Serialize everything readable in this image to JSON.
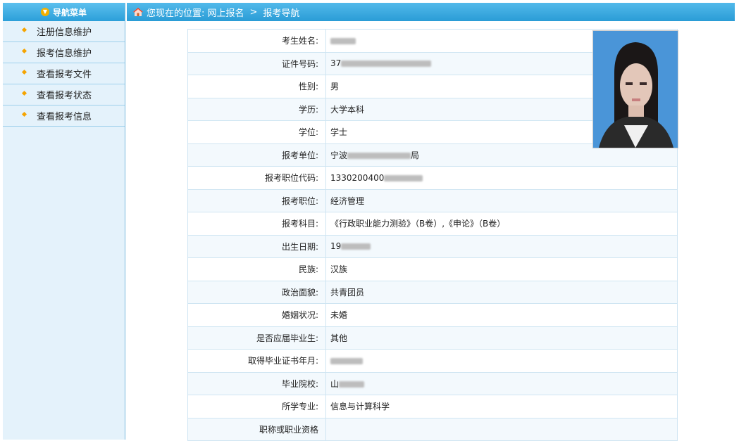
{
  "sidebar": {
    "title": "导航菜单",
    "items": [
      {
        "label": "注册信息维护"
      },
      {
        "label": "报考信息维护"
      },
      {
        "label": "查看报考文件"
      },
      {
        "label": "查看报考状态"
      },
      {
        "label": "查看报考信息"
      }
    ]
  },
  "breadcrumb": {
    "prefix": "您现在的位置: 网上报名",
    "separator": ">",
    "current": "报考导航"
  },
  "rows": [
    {
      "key": "考生姓名:",
      "value": "",
      "redacted": true
    },
    {
      "key": "证件号码:",
      "value": "37",
      "redacted": true
    },
    {
      "key": "性别:",
      "value": "男"
    },
    {
      "key": "学历:",
      "value": "大学本科"
    },
    {
      "key": "学位:",
      "value": "学士"
    },
    {
      "key": "报考单位:",
      "value": "宁波",
      "suffix": "局",
      "redacted": true
    },
    {
      "key": "报考职位代码:",
      "value": "1330200400",
      "redacted": true
    },
    {
      "key": "报考职位:",
      "value": "经济管理"
    },
    {
      "key": "报考科目:",
      "value": "《行政职业能力测验》（B卷）,《申论》（B卷）"
    },
    {
      "key": "出生日期:",
      "value": "19",
      "redacted": true
    },
    {
      "key": "民族:",
      "value": "汉族"
    },
    {
      "key": "政治面貌:",
      "value": "共青团员"
    },
    {
      "key": "婚姻状况:",
      "value": "未婚"
    },
    {
      "key": "是否应届毕业生:",
      "value": "其他"
    },
    {
      "key": "取得毕业证书年月:",
      "value": "",
      "redacted": true
    },
    {
      "key": "毕业院校:",
      "value": "山",
      "redacted": true
    },
    {
      "key": "所学专业:",
      "value": "信息与计算科学"
    },
    {
      "key": "职称或职业资格",
      "value": ""
    }
  ]
}
